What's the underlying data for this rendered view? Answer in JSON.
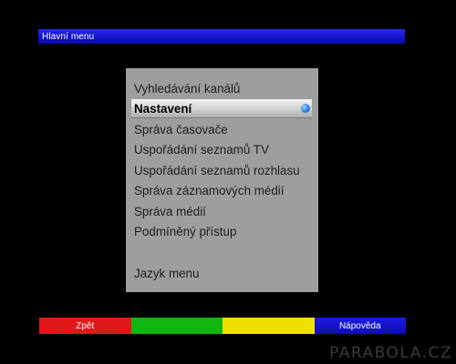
{
  "window": {
    "title": "Hlavní menu"
  },
  "menu": {
    "items": [
      {
        "label": "Vyhledávání kanálů",
        "selected": false
      },
      {
        "label": "Nastavení",
        "selected": true
      },
      {
        "label": "Správa časovače",
        "selected": false
      },
      {
        "label": "Uspořádání seznamů TV",
        "selected": false
      },
      {
        "label": "Uspořádání seznamů rozhlasu",
        "selected": false
      },
      {
        "label": "Správa záznamových médií",
        "selected": false
      },
      {
        "label": "Správa médií",
        "selected": false
      },
      {
        "label": "Podmíněný přístup",
        "selected": false
      },
      {
        "label": "Jazyk menu",
        "selected": false
      }
    ],
    "selected_indicator_icon": "ok-circle-icon",
    "selected_indicator_glyph": "●"
  },
  "buttons": {
    "red": {
      "label": "Zpět",
      "color": "#e01818"
    },
    "green": {
      "label": "",
      "color": "#12b612"
    },
    "yellow": {
      "label": "",
      "color": "#f0e000"
    },
    "blue": {
      "label": "Nápověda",
      "color": "#1a1ae0"
    }
  },
  "watermark": "PARABOLA.CZ",
  "colors": {
    "title_bar": "#1515d0",
    "panel": "#9e9e9e",
    "background": "#000000"
  }
}
